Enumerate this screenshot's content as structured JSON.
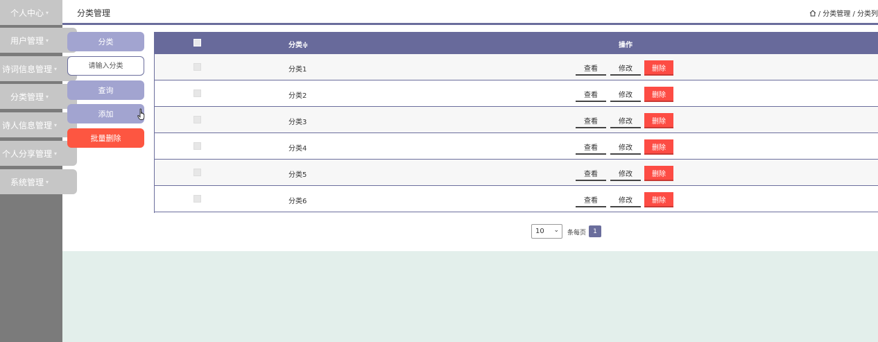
{
  "sidebar": {
    "items": [
      {
        "label": "个人中心"
      },
      {
        "label": "用户管理"
      },
      {
        "label": "诗词信息管理"
      },
      {
        "label": "分类管理"
      },
      {
        "label": "诗人信息管理"
      },
      {
        "label": "个人分享管理"
      },
      {
        "label": "系统管理"
      }
    ],
    "caret": "▾"
  },
  "header": {
    "title": "分类管理",
    "breadcrumb": "/ 分类管理 / 分类列"
  },
  "actions": {
    "category_button": "分类",
    "search_placeholder": "请输入分类",
    "query_button": "查询",
    "add_button": "添加",
    "batch_delete_button": "批量删除"
  },
  "table": {
    "columns": {
      "name": "分类≑",
      "operation": "操作"
    },
    "rows": [
      {
        "name": "分类1"
      },
      {
        "name": "分类2"
      },
      {
        "name": "分类3"
      },
      {
        "name": "分类4"
      },
      {
        "name": "分类5"
      },
      {
        "name": "分类6"
      }
    ],
    "row_actions": {
      "view": "查看",
      "edit": "修改",
      "delete": "删除"
    }
  },
  "pagination": {
    "page_size": "10",
    "per_page_label": "条每页",
    "current_page": "1"
  },
  "colors": {
    "accent": "#686a9b",
    "button_purple": "#a2a4d0",
    "danger": "#fd4c44",
    "sidebar_bg": "#7b7b7b"
  }
}
